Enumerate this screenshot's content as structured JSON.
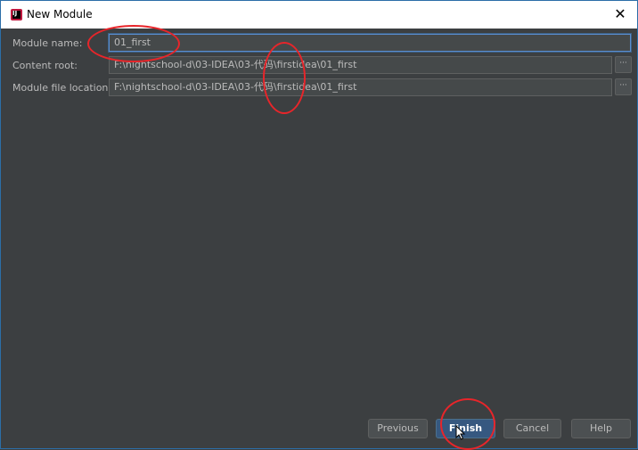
{
  "window": {
    "title": "New Module",
    "close_glyph": "✕"
  },
  "form": {
    "module_name": {
      "label": "Module name:",
      "value": "01_first"
    },
    "content_root": {
      "label": "Content root:",
      "value": "F:\\nightschool-d\\03-IDEA\\03-代码\\firstidea\\01_first",
      "browse": "···"
    },
    "module_file_location": {
      "label": "Module file location:",
      "value": "F:\\nightschool-d\\03-IDEA\\03-代码\\firstidea\\01_first",
      "browse": "···"
    }
  },
  "buttons": {
    "previous": "Previous",
    "finish": "Finish",
    "cancel": "Cancel",
    "help": "Help"
  },
  "colors": {
    "background": "#3c3f41",
    "field": "#45494a",
    "default_button": "#365880",
    "annotation": "#e8252a"
  }
}
